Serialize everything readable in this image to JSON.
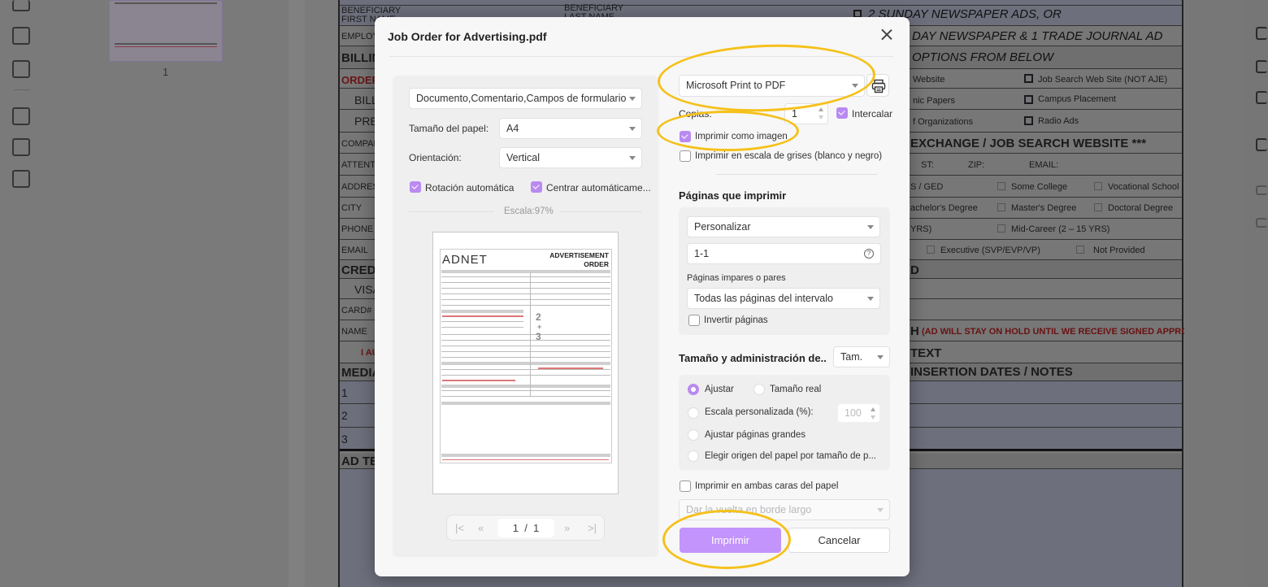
{
  "background_app": {
    "thumbnail_page_number": "1",
    "document_left_labels": [
      "BENEFICIARY FIRST NAME",
      "EMPLOYER",
      "BILLING",
      "ORDER",
      "BILL",
      "PRE",
      "COMPANY",
      "ATTENTION",
      "ADDRESS",
      "CITY",
      "PHONE",
      "EMAIL",
      "CREDIT",
      "VISA",
      "CARD#",
      "NAME",
      "I AU",
      "MEDIA",
      "1",
      "2",
      "3",
      "AD TEXT"
    ],
    "document_top_label": "BENEFICIARY LAST NAME",
    "document_right": {
      "option_lines": [
        "2 SUNDAY NEWSPAPER ADS, OR",
        "DAY NEWSPAPER & 1 TRADE JOURNAL AD",
        "OPTIONS FROM BELOW"
      ],
      "checkbox_col1": [
        "Website",
        "nic Papers",
        "f Organizations"
      ],
      "checkbox_col2": [
        "Job Search Web Site (NOT AJE)",
        "Campus Placement",
        "Radio Ads"
      ],
      "exchange_header": "EXCHANGE / JOB SEARCH WEBSITE ***",
      "address_fields": [
        "ST:",
        "ZIP:",
        "EMAIL:"
      ],
      "education": [
        "S / GED",
        "Some College",
        "Vocational School",
        "achelor's Degree",
        "Master's Degree",
        "Doctoral Degree"
      ],
      "career": [
        "YRS)",
        "Mid-Career (2 – 15 YRS)"
      ],
      "level": [
        "Executive (SVP/EVP/VP)",
        "Not Provided"
      ],
      "hold_notice_prefix": "H",
      "hold_notice": "(AD WILL STAY ON HOLD UNTIL WE RECEIVE SIGNED APPROVAL)",
      "text_label": "TEXT",
      "insertion_header": "INSERTION DATES / NOTES",
      "row0_char": "D"
    }
  },
  "dialog": {
    "title": "Job Order for Advertising.pdf",
    "close_icon": "close-icon",
    "left": {
      "content_select": "Documento,Comentario,Campos de formulario",
      "paper_size_label": "Tamaño del papel:",
      "paper_size_value": "A4",
      "orientation_label": "Orientación:",
      "orientation_value": "Vertical",
      "auto_rotate_label": "Rotación automática",
      "auto_rotate_checked": true,
      "auto_center_label": "Centrar automáticame...",
      "auto_center_checked": true,
      "scale_text": "Escala:97%",
      "preview": {
        "logo": "ADNET",
        "heading_line1": "ADVERTISEMENT",
        "heading_line2": "ORDER",
        "numbers": [
          "2",
          "+",
          "3"
        ]
      },
      "pager": {
        "first_icon": "first-page-icon",
        "prev_icon": "previous-page-icon",
        "current": "1",
        "separator": "/",
        "total": "1",
        "next_icon": "next-page-icon",
        "last_icon": "last-page-icon"
      }
    },
    "right": {
      "printer_value": "Microsoft Print to PDF",
      "printer_settings_icon": "printer-icon",
      "copies_label": "Copias:",
      "copies_value": "1",
      "collate_label": "Intercalar",
      "collate_checked": true,
      "print_as_image_label": "Imprimir como imagen",
      "print_as_image_checked": true,
      "grayscale_label": "Imprimir en escala de grises (blanco y negro)",
      "grayscale_checked": false,
      "pages_section_title": "Páginas que imprimir",
      "pages_mode": "Personalizar",
      "pages_range": "1-1",
      "odd_even_label": "Páginas impares o pares",
      "odd_even_value": "Todas las páginas del intervalo",
      "reverse_label": "Invertir páginas",
      "reverse_checked": false,
      "size_section_title": "Tamaño y administración de..",
      "size_mode_select": "Tam.",
      "size_options": [
        {
          "label": "Ajustar",
          "selected": true
        },
        {
          "label": "Tamaño real",
          "selected": false
        },
        {
          "label": "Escala personalizada (%):",
          "selected": false
        },
        {
          "label": "Ajustar páginas grandes",
          "selected": false
        },
        {
          "label": "Elegir origen del papel por tamaño de p...",
          "selected": false
        }
      ],
      "custom_scale_value": "100",
      "duplex_label": "Imprimir en ambas caras del papel",
      "duplex_checked": false,
      "flip_select": "Dar la vuelta en borde largo",
      "print_button": "Imprimir",
      "cancel_button": "Cancelar"
    }
  },
  "colors": {
    "accent": "#b98af0",
    "print_button": "#c394fb",
    "highlight_ring": "#f5c11a"
  }
}
